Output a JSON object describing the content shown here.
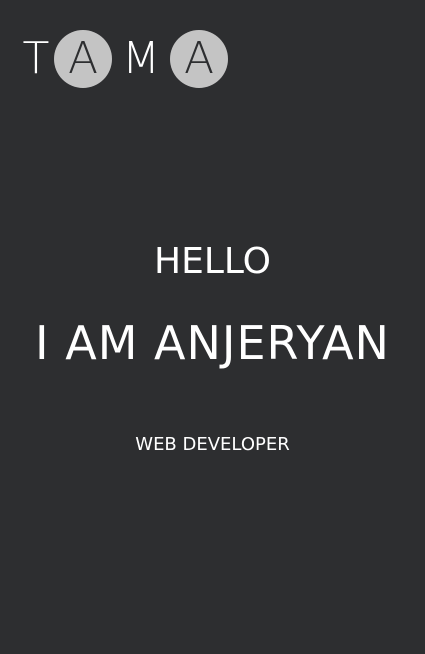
{
  "logo": {
    "letters": [
      "T",
      "A",
      "M",
      "A"
    ]
  },
  "hero": {
    "greeting": "HELLO",
    "name": "I AM ANJERYAN",
    "role": "WEB DEVELOPER"
  },
  "colors": {
    "background": "#2d2e30",
    "text": "#ffffff",
    "logo_circle": "#c4c4c4"
  }
}
